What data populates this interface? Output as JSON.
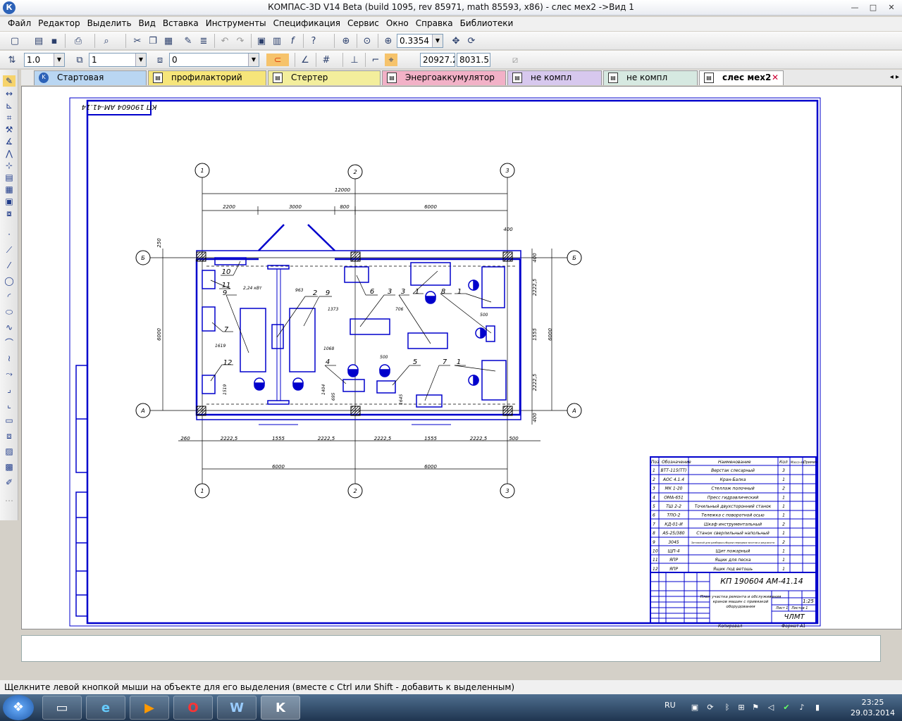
{
  "window": {
    "title": "КОМПАС-3D V14 Beta (build 1095, rev 85971, math 85593, x86) - слес мех2 ->Вид 1",
    "app_icon_letter": "К",
    "minimize": "—",
    "maximize": "□",
    "close": "✕"
  },
  "menu": [
    "Файл",
    "Редактор",
    "Выделить",
    "Вид",
    "Вставка",
    "Инструменты",
    "Спецификация",
    "Сервис",
    "Окно",
    "Справка",
    "Библиотеки"
  ],
  "toolbar1": {
    "zoom_value": "0.3354"
  },
  "toolbar2": {
    "line_scale": "1.0",
    "step": "1",
    "layer": "0",
    "coord_x": "20927.28",
    "coord_y": "8031.51"
  },
  "tabs": [
    {
      "label": "Стартовая страница",
      "color": "#b9d6f2"
    },
    {
      "label": "профилакторий камаз",
      "color": "#f6e57a"
    },
    {
      "label": "Стертер технологич",
      "color": "#f3ee9c"
    },
    {
      "label": "Энергоаккумулятор СБ",
      "color": "#f2b1c7"
    },
    {
      "label": "не компл гараж",
      "color": "#d7c8ee"
    },
    {
      "label": "не компл гараж",
      "color": "#d6e9e1"
    },
    {
      "label": "слес мех2",
      "color": "#ffffff"
    }
  ],
  "tab_close": "✕",
  "drawing": {
    "stamp_code": "КП 190604 АМ-41.14",
    "axes_num": [
      "1",
      "2",
      "3"
    ],
    "axes_let": [
      "Б",
      "А"
    ],
    "dims_top": [
      "12000",
      "2200",
      "3000",
      "800",
      "6000",
      "400"
    ],
    "dims_bottom": [
      "260",
      "2222,5",
      "1555",
      "2222,5",
      "2222,5",
      "1555",
      "2222,5",
      "500"
    ],
    "dims_bottom2": [
      "6000",
      "6000"
    ],
    "dims_left": [
      "250",
      "6000"
    ],
    "dims_right": [
      "400",
      "2222,5",
      "1555",
      "2222,5",
      "400",
      "6000"
    ],
    "dims_inner": [
      "2,24 кВт",
      "963",
      "1373",
      "706",
      "500",
      "1619",
      "1068",
      "500",
      "1519",
      "1404",
      "695",
      "1645"
    ],
    "callouts": [
      "10",
      "11",
      "9",
      "7",
      "12",
      "2",
      "9",
      "6",
      "3",
      "3",
      "1",
      "8",
      "1",
      "4",
      "5",
      "7",
      "1"
    ],
    "spec_headers": [
      "Поз",
      "Обозначение",
      "Наименование",
      "Кол",
      "Масса ед.",
      "Примеч"
    ],
    "spec_rows": [
      {
        "pos": "1",
        "code": "ВТТ-115(ТТ)",
        "name": "Верстак слесарный",
        "qty": "3"
      },
      {
        "pos": "2",
        "code": "АОС 4.1.4",
        "name": "Кран-Балка",
        "qty": "1"
      },
      {
        "pos": "3",
        "code": "МК 1-20",
        "name": "Стеллаж полочный",
        "qty": "2"
      },
      {
        "pos": "4",
        "code": "ОМА-651",
        "name": "Пресс гидравлический",
        "qty": "1"
      },
      {
        "pos": "5",
        "code": "ТШ 2-2",
        "name": "Точильный двухсторонний станок",
        "qty": "1"
      },
      {
        "pos": "6",
        "code": "ТПО-2",
        "name": "Тележка с поворотной осью",
        "qty": "1"
      },
      {
        "pos": "7",
        "code": "КД-01-И",
        "name": "Шкаф инструментальный",
        "qty": "2"
      },
      {
        "pos": "8",
        "code": "АS-25/380",
        "name": "Станок сверлильный напольный",
        "qty": "1"
      },
      {
        "pos": "9",
        "code": "3045",
        "name": "Затяжной для разборки-сборки передних мостов и ред.моста",
        "qty": "2"
      },
      {
        "pos": "10",
        "code": "ЩП-4",
        "name": "Щит пожарный",
        "qty": "1"
      },
      {
        "pos": "11",
        "code": "ЯПР",
        "name": "Ящик для песка",
        "qty": "1"
      },
      {
        "pos": "12",
        "code": "ЯПР",
        "name": "Ящик под ветошь",
        "qty": "1"
      }
    ],
    "stamp_title_lines": [
      "План участка ремонта и обслуживания",
      "кранов машин с привязкой",
      "оборудования"
    ],
    "stamp_scale": "1:25",
    "stamp_org": "ЧЛМТ",
    "stamp_sheet": "Лист 1",
    "stamp_sheets": "Листов 1",
    "stamp_copy": "Копировал",
    "stamp_format": "Формат А1"
  },
  "status": {
    "hint": "Щелкните левой кнопкой мыши на объекте для его выделения (вместе с Ctrl или Shift - добавить к выделенным)"
  },
  "taskbar": {
    "apps": [
      "explorer-icon",
      "ie-icon",
      "media-icon",
      "opera-icon",
      "word-icon",
      "kompas-icon"
    ],
    "app_glyphs": [
      "▭",
      "e",
      "▶",
      "O",
      "W",
      "K"
    ],
    "lang": "RU",
    "time": "23:25",
    "date": "29.03.2014"
  }
}
